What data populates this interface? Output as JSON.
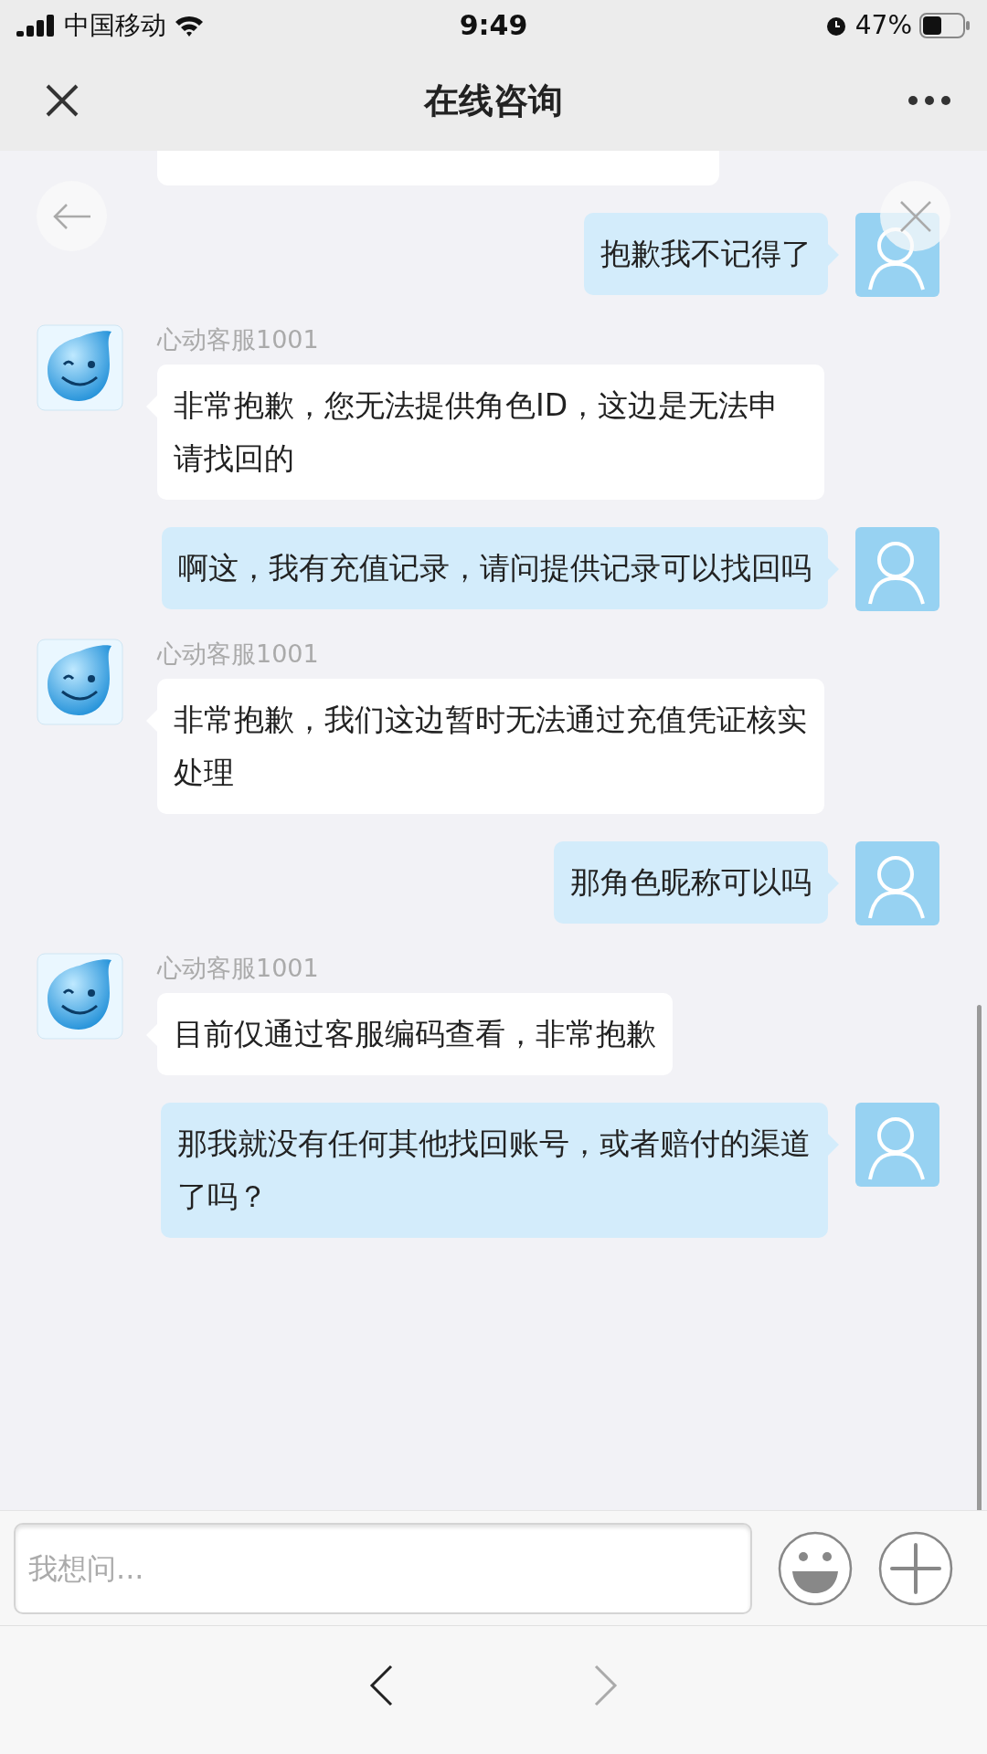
{
  "status_bar": {
    "carrier": "中国移动",
    "time": "9:49",
    "battery": "47%"
  },
  "header": {
    "title": "在线咨询"
  },
  "messages": [
    {
      "kind": "user",
      "text": "抱歉我不记得了"
    },
    {
      "kind": "agent",
      "name": "心动客服1001",
      "text": "非常抱歉，您无法提供角色ID，这边是无法申请找回的"
    },
    {
      "kind": "user",
      "text": "啊这，我有充值记录，请问提供记录可以找回吗"
    },
    {
      "kind": "agent",
      "name": "心动客服1001",
      "text": "非常抱歉，我们这边暂时无法通过充值凭证核实处理"
    },
    {
      "kind": "user",
      "text": "那角色昵称可以吗"
    },
    {
      "kind": "agent",
      "name": "心动客服1001",
      "text": "目前仅通过客服编码查看，非常抱歉"
    },
    {
      "kind": "user",
      "text": "那我就没有任何其他找回账号，或者赔付的渠道了吗？"
    }
  ],
  "input": {
    "placeholder": "我想问..."
  },
  "nav": [
    {
      "kind": "back",
      "disabled": false
    },
    {
      "kind": "forward",
      "disabled": true
    }
  ]
}
